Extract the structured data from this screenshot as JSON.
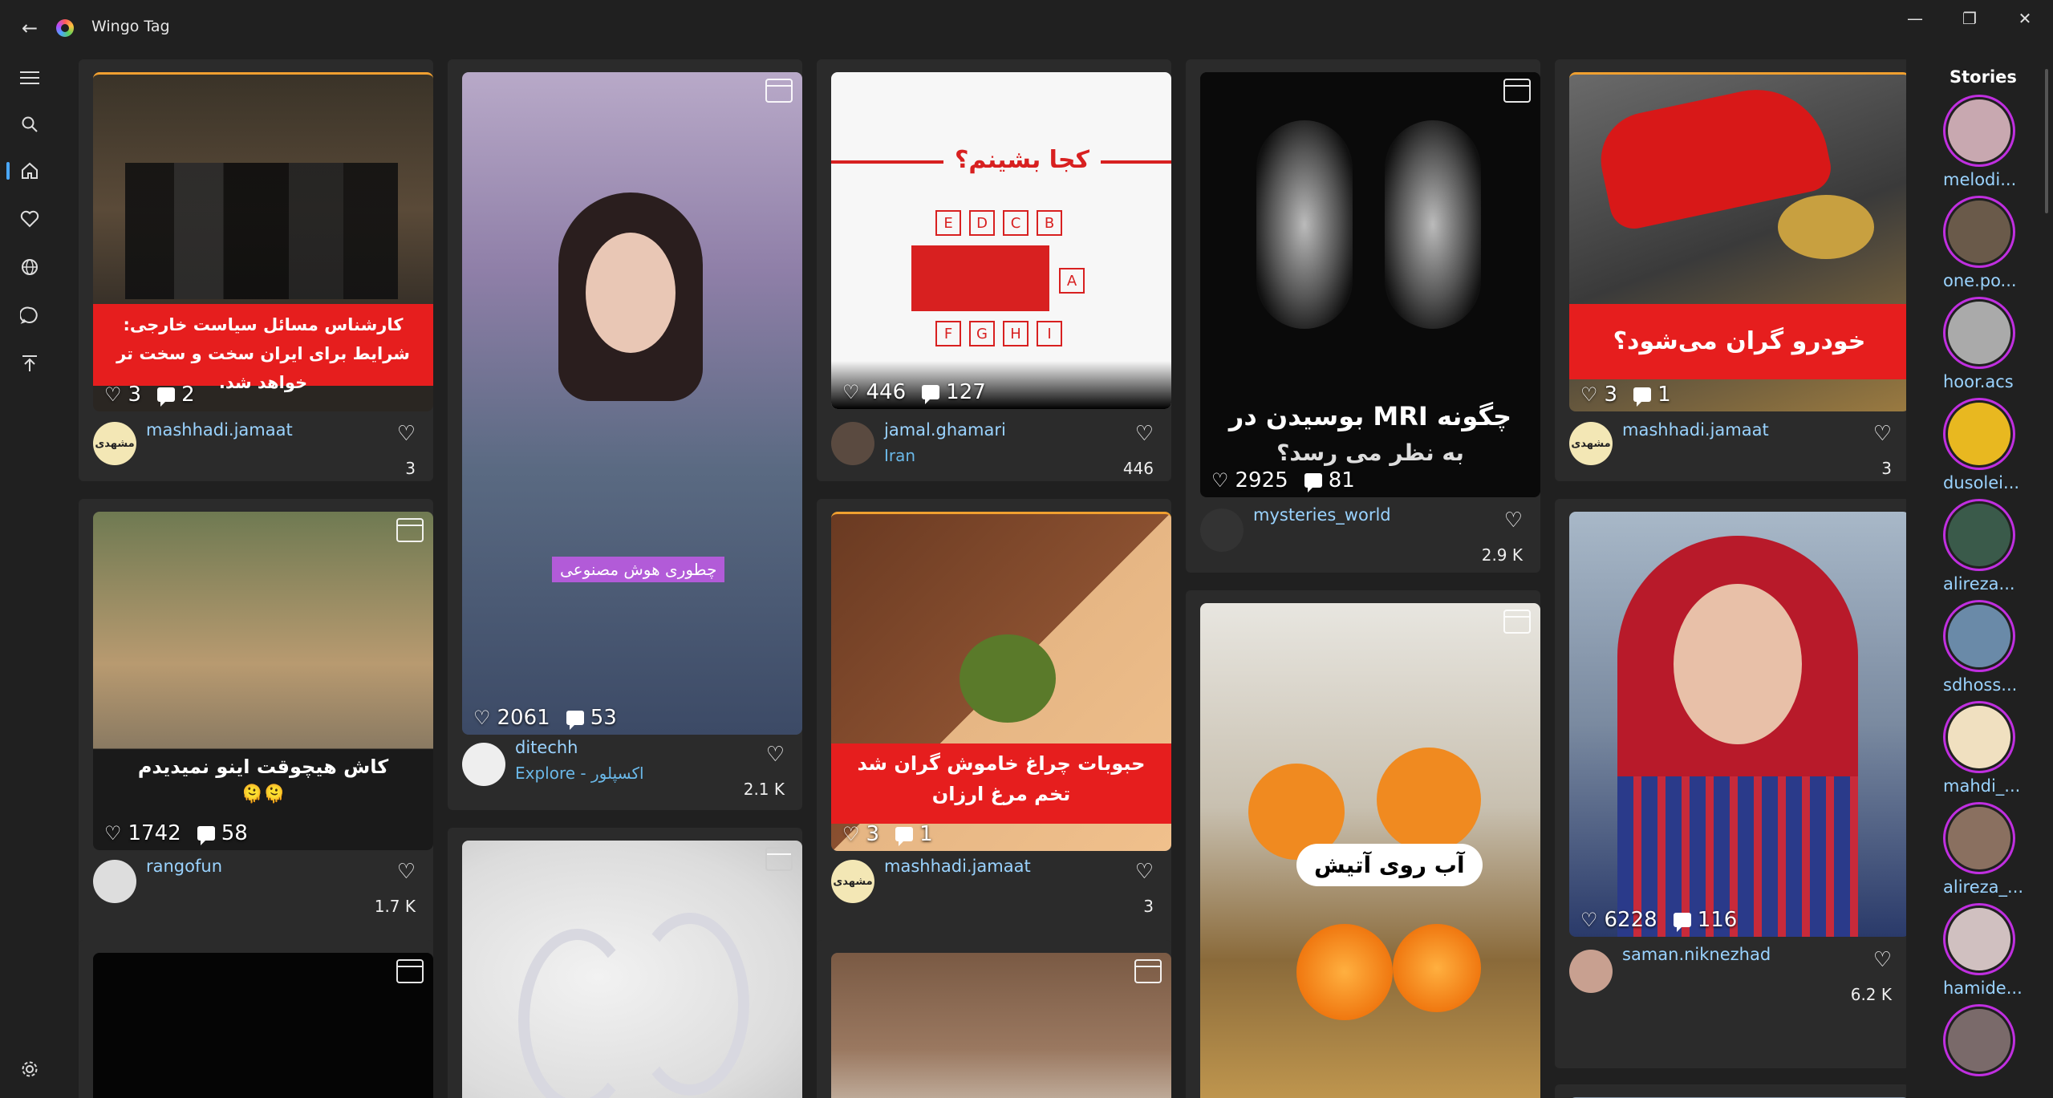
{
  "app": {
    "title": "Wingo Tag"
  },
  "window_controls": {
    "minimize": "—",
    "restore": "❐",
    "close": "✕"
  },
  "sidebar": {
    "items": [
      "menu",
      "search",
      "home",
      "likes",
      "explore",
      "messages",
      "upload",
      "settings"
    ]
  },
  "colors": {
    "accent": "#4aa8ff",
    "banner_red": "#e61e1e",
    "story_ring": "#c02fe0",
    "username": "#9ad3ff"
  },
  "posts": {
    "c1p1": {
      "banner": "کارشناس مسائل سیاست خارجی:\nشرایط برای ایران سخت و سخت تر خواهد شد.",
      "likes": "3",
      "comments": "2",
      "user": "mashhadi.jamaat",
      "count": "3"
    },
    "c1p2": {
      "caption": "کاش هیچوقت اینو نمیدیدم",
      "emoji": "🫠🫠",
      "likes": "1742",
      "comments": "58",
      "user": "rangofun",
      "count": "1.7 K"
    },
    "c2p1": {
      "overlay": "چطوری هوش مصنوعی",
      "likes": "2061",
      "comments": "53",
      "user": "ditechh",
      "sub": "Explore - اکسپلور",
      "count": "2.1 K"
    },
    "c3p1": {
      "heading": "کجا بشینم؟",
      "seats_top": [
        "E",
        "D",
        "C",
        "B"
      ],
      "seat_a": "A",
      "seats_bottom": [
        "F",
        "G",
        "H",
        "I"
      ],
      "likes": "446",
      "comments": "127",
      "user": "jamal.ghamari",
      "sub": "Iran",
      "count": "446"
    },
    "c3p2": {
      "banner": "حبوبات چراغ خاموش گران شد\nتخم مرغ ارزان",
      "likes": "3",
      "comments": "1",
      "user": "mashhadi.jamaat",
      "count": "3"
    },
    "c4p1": {
      "title_line1": "بوسیدن در MRI چگونه",
      "title_line2": "به نظر می رسد؟",
      "likes": "2925",
      "comments": "81",
      "user": "mysteries_world",
      "count": "2.9 K"
    },
    "c4p2": {
      "caption": "آب روی آتیش"
    },
    "c5p1": {
      "banner": "خودرو گران می‌شود؟",
      "likes": "3",
      "comments": "1",
      "user": "mashhadi.jamaat",
      "count": "3"
    },
    "c5p2": {
      "likes": "6228",
      "comments": "116",
      "user": "saman.niknezhad",
      "count": "6.2 K"
    }
  },
  "stories": {
    "title": "Stories",
    "items": [
      "melodi...",
      "one.po...",
      "hoor.acs",
      "dusolei...",
      "alireza...",
      "sdhoss...",
      "mahdi_...",
      "alireza_...",
      "hamide..."
    ]
  }
}
